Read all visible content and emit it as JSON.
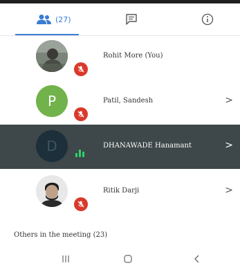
{
  "tabs": {
    "people_count": "(27)",
    "active_tab": "people"
  },
  "participants": [
    {
      "name": "Rohit More (You)",
      "muted": true,
      "avatar": "photo"
    },
    {
      "name": "Patil, Sandesh",
      "muted": true,
      "avatar": "letter",
      "letter": "P",
      "avatar_color": "#71b34a",
      "has_chevron": true
    },
    {
      "name": "DHANAWADE Hanamant",
      "speaking": true,
      "avatar": "letter",
      "letter": "D",
      "avatar_color": "#1c2f3a",
      "has_chevron": true,
      "highlighted": true
    },
    {
      "name": "Ritik Darji",
      "muted": true,
      "avatar": "photo",
      "has_chevron": true
    }
  ],
  "others_label": "Others in the meeting (23)",
  "colors": {
    "accent": "#3a7bd5",
    "muted_badge": "#d93a2b",
    "speaking": "#2fd36f",
    "highlight_row": "#3e4749"
  }
}
